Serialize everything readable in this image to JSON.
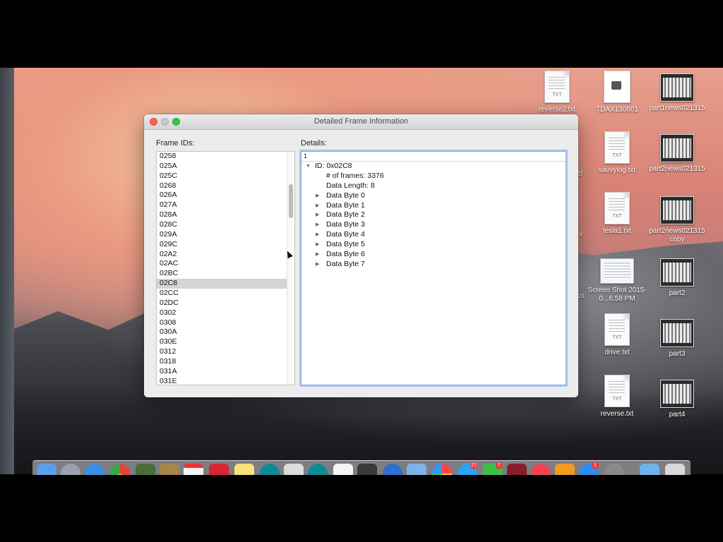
{
  "desktop": {
    "icons": [
      {
        "label": "reverse2.txt",
        "type": "txt",
        "tag": "TXT"
      },
      {
        "label": "TDAX130601",
        "type": "pdf"
      },
      {
        "label": "part1news021315",
        "type": "shot"
      },
      {
        "label": "savvylog.txt",
        "type": "txt",
        "tag": "TXT"
      },
      {
        "label": "part2news021315",
        "type": "shot"
      },
      {
        "label": "tesla1.txt",
        "type": "txt",
        "tag": "TXT"
      },
      {
        "label": "part2news021315 copy",
        "type": "shot"
      },
      {
        "label": "Screen Shot 2015-0...6.58 PM",
        "type": "wshot"
      },
      {
        "label": "part2",
        "type": "shot"
      },
      {
        "label": "drive.txt",
        "type": "txt",
        "tag": "TXT"
      },
      {
        "label": "part3",
        "type": "shot"
      },
      {
        "label": "reverse.txt",
        "type": "txt",
        "tag": "TXT"
      },
      {
        "label": "part4",
        "type": "shot"
      }
    ],
    "partial_labels": [
      "cl",
      "v",
      "cs"
    ]
  },
  "window": {
    "title": "Detailed Frame Information",
    "frame_ids_label": "Frame IDs:",
    "details_label": "Details:",
    "frame_ids": [
      "0258",
      "025A",
      "025C",
      "0268",
      "026A",
      "027A",
      "028A",
      "028C",
      "029A",
      "029C",
      "02A2",
      "02AC",
      "02BC",
      "02C8",
      "02CC",
      "02DC",
      "0302",
      "0308",
      "030A",
      "030E",
      "0312",
      "0318",
      "031A",
      "031E"
    ],
    "selected_frame": "02C8",
    "details_filter": "1",
    "tree": {
      "root": "ID: 0x02C8",
      "frames": "# of frames: 3376",
      "data_length": "Data Length: 8",
      "bytes": [
        "Data Byte 0",
        "Data Byte 1",
        "Data Byte 2",
        "Data Byte 3",
        "Data Byte 4",
        "Data Byte 5",
        "Data Byte 6",
        "Data Byte 7"
      ]
    }
  },
  "dock": {
    "badges": [
      "21",
      "7",
      "1"
    ]
  }
}
